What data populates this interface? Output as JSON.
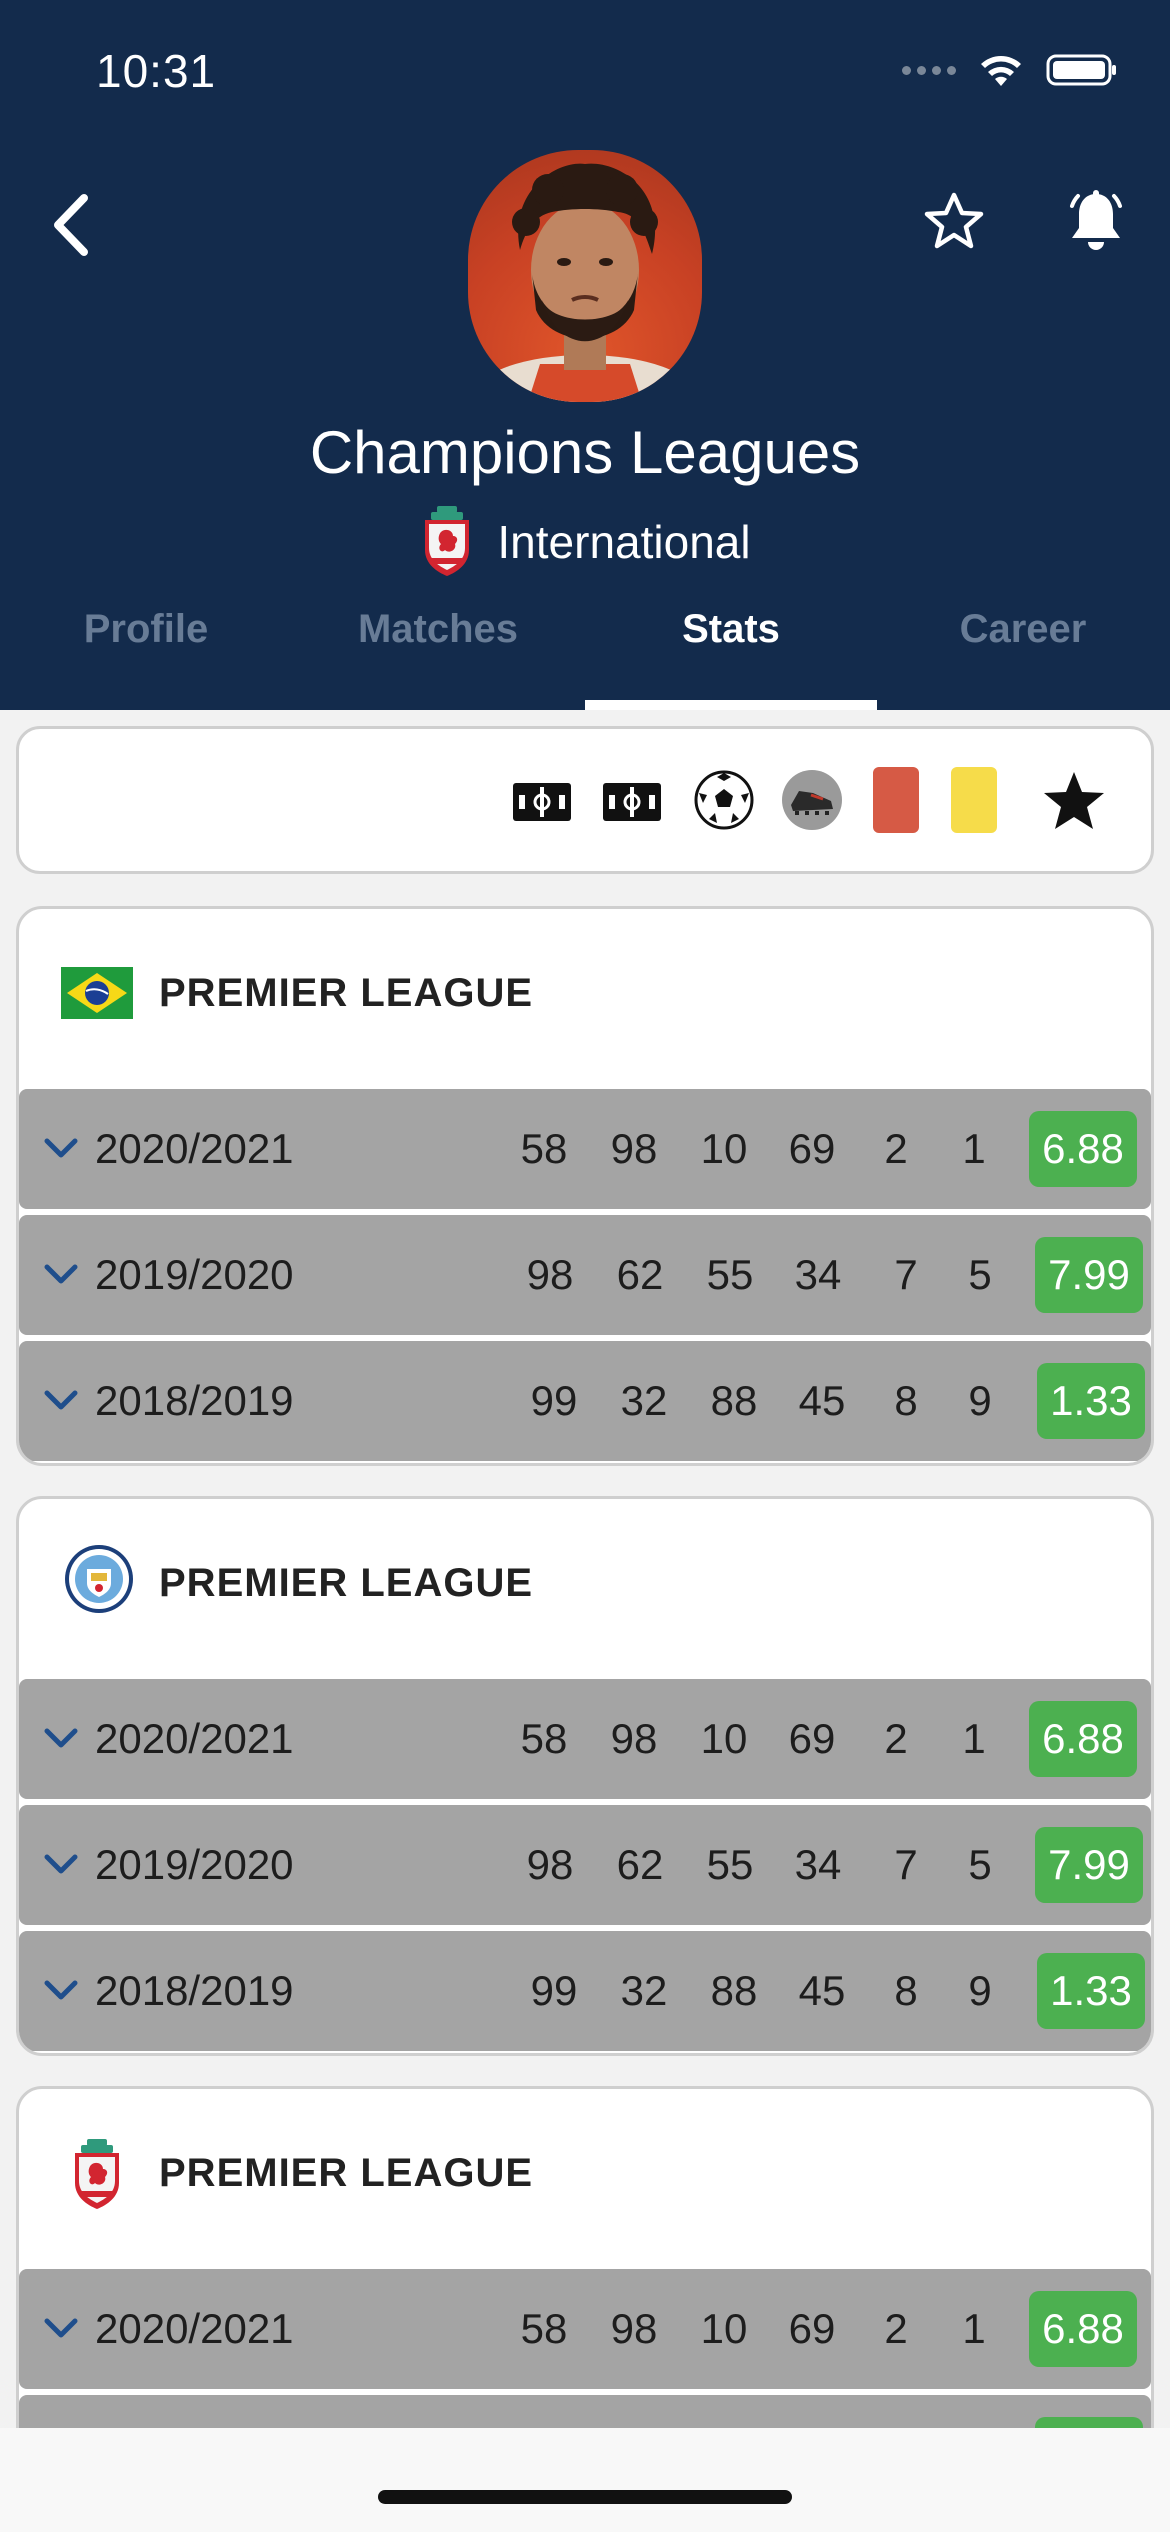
{
  "status_bar": {
    "time": "10:31"
  },
  "header": {
    "title": "Champions Leagues",
    "subtitle": "International",
    "icons": {
      "back": "chevron-left-icon",
      "favorite": "star-outline-icon",
      "notifications": "bell-icon"
    }
  },
  "tabs": [
    {
      "label": "Profile"
    },
    {
      "label": "Matches"
    },
    {
      "label": "Stats"
    },
    {
      "label": "Career"
    }
  ],
  "active_tab": "Stats",
  "stat_icons": [
    "pitch-icon",
    "pitch-icon",
    "soccer-ball-icon",
    "boot-icon",
    "red-card-icon",
    "yellow-card-icon",
    "star-icon"
  ],
  "cards": [
    {
      "title": "PREMIER LEAGUE",
      "logo": "brazil-flag-icon",
      "rows": [
        {
          "season": "2020/2021",
          "stats": [
            "58",
            "98",
            "10",
            "69",
            "2",
            "1"
          ],
          "rating": "6.88"
        },
        {
          "season": "2019/2020",
          "stats": [
            "98",
            "62",
            "55",
            "34",
            "7",
            "5"
          ],
          "rating": "7.99"
        },
        {
          "season": "2018/2019",
          "stats": [
            "99",
            "32",
            "88",
            "45",
            "8",
            "9"
          ],
          "rating": "1.33"
        }
      ]
    },
    {
      "title": "PREMIER LEAGUE",
      "logo": "manchester-city-crest-icon",
      "rows": [
        {
          "season": "2020/2021",
          "stats": [
            "58",
            "98",
            "10",
            "69",
            "2",
            "1"
          ],
          "rating": "6.88"
        },
        {
          "season": "2019/2020",
          "stats": [
            "98",
            "62",
            "55",
            "34",
            "7",
            "5"
          ],
          "rating": "7.99"
        },
        {
          "season": "2018/2019",
          "stats": [
            "99",
            "32",
            "88",
            "45",
            "8",
            "9"
          ],
          "rating": "1.33"
        }
      ]
    },
    {
      "title": "PREMIER LEAGUE",
      "logo": "liverpool-crest-icon",
      "rows": [
        {
          "season": "2020/2021",
          "stats": [
            "58",
            "98",
            "10",
            "69",
            "2",
            "1"
          ],
          "rating": "6.88"
        }
      ]
    }
  ],
  "colors": {
    "header_bg": "#132b4c",
    "row_bg": "#a4a4a4",
    "rating_bg": "#4cb050",
    "tab_inactive": "#687c96",
    "chevron": "#1f4e8c"
  }
}
